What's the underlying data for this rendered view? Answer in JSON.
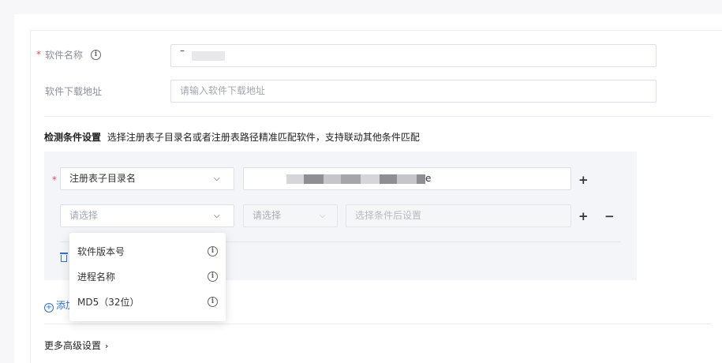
{
  "form": {
    "software_name": {
      "required_mark": "*",
      "label": "软件名称",
      "value": "–"
    },
    "download_url": {
      "label": "软件下载地址",
      "placeholder": "请输入软件下载地址"
    }
  },
  "detection": {
    "title": "检测条件设置",
    "description": "选择注册表子目录名或者注册表路径精准匹配软件，支持联动其他条件匹配",
    "row1": {
      "required_mark": "*",
      "select_value": "注册表子目录名",
      "input_value_visible_suffix": "e",
      "add_label": "+"
    },
    "row2": {
      "select_placeholder": "请选择",
      "operator_placeholder": "请选择",
      "value_placeholder": "选择条件后设置",
      "add_label": "+",
      "remove_label": "−"
    },
    "dropdown_options": [
      {
        "label": "软件版本号"
      },
      {
        "label": "进程名称"
      },
      {
        "label": "MD5（32位）"
      }
    ],
    "add_condition_label": "添加"
  },
  "advanced": {
    "label": "更多高级设置"
  },
  "icons": {
    "info": "info-circle-icon",
    "chevron_down": "chevron-down-icon",
    "chevron_right": "chevron-right-icon",
    "trash": "trash-icon",
    "add_circle": "plus-circle-icon"
  },
  "colors": {
    "accent": "#2f6fe0",
    "required": "#e34d59",
    "panel_bg": "#f4f5f8"
  }
}
